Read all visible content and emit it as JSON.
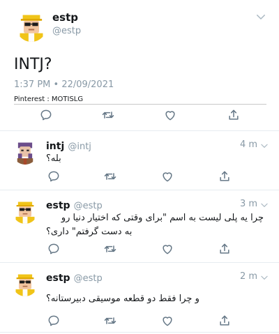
{
  "main": {
    "name": "estp",
    "handle": "@estp",
    "text": "INTJ?",
    "timestamp": "1:37 PM • 22/09/2021",
    "watermark": "Pinterest : MOTISLG"
  },
  "replies": [
    {
      "name": "intj",
      "handle": "@intj",
      "time": "4 m",
      "text": "بله؟"
    },
    {
      "name": "estp",
      "handle": "@estp",
      "time": "3 m",
      "line1": "چرا یه پلی لیست به اسم \"برای وقتی که اختیار دنیا رو",
      "line2": "به دست گرفتم\" داری؟"
    },
    {
      "name": "estp",
      "handle": "@estp",
      "time": "2 m",
      "text": "و چرا فقط دو قطعه موسیقی دبیرستانه؟"
    }
  ],
  "icons": [
    "reply-icon",
    "retweet-icon",
    "like-icon",
    "share-icon"
  ],
  "colors": {
    "accent": "#1da1f2",
    "muted": "#8899a6",
    "text": "#14171a",
    "divider": "#e6ecf0"
  }
}
